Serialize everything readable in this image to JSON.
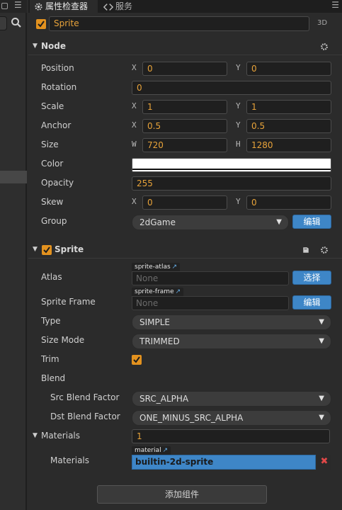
{
  "colors": {
    "accent": "#e8a33a",
    "checkbox": "#e3921f",
    "button_blue": "#3e86c7",
    "remove_red": "#e04848"
  },
  "tabs": {
    "inspector_label": "属性检查器",
    "services_label": "服务"
  },
  "node_name": "Sprite",
  "mode_tag": "3D",
  "node_section": {
    "title": "Node",
    "properties": {
      "position": {
        "label": "Position",
        "x_axis": "X",
        "x": "0",
        "y_axis": "Y",
        "y": "0"
      },
      "rotation": {
        "label": "Rotation",
        "value": "0"
      },
      "scale": {
        "label": "Scale",
        "x_axis": "X",
        "x": "1",
        "y_axis": "Y",
        "y": "1"
      },
      "anchor": {
        "label": "Anchor",
        "x_axis": "X",
        "x": "0.5",
        "y_axis": "Y",
        "y": "0.5"
      },
      "size": {
        "label": "Size",
        "w_axis": "W",
        "w": "720",
        "h_axis": "H",
        "h": "1280"
      },
      "color": {
        "label": "Color",
        "value": "#ffffff"
      },
      "opacity": {
        "label": "Opacity",
        "value": "255"
      },
      "skew": {
        "label": "Skew",
        "x_axis": "X",
        "x": "0",
        "y_axis": "Y",
        "y": "0"
      },
      "group": {
        "label": "Group",
        "value": "2dGame",
        "edit_button": "编辑"
      }
    }
  },
  "sprite_section": {
    "title": "Sprite",
    "enabled": true,
    "properties": {
      "atlas": {
        "label": "Atlas",
        "tag": "sprite-atlas",
        "placeholder": "None",
        "button": "选择"
      },
      "sprite_frame": {
        "label": "Sprite Frame",
        "tag": "sprite-frame",
        "placeholder": "None",
        "button": "编辑"
      },
      "type": {
        "label": "Type",
        "value": "SIMPLE"
      },
      "size_mode": {
        "label": "Size Mode",
        "value": "TRIMMED"
      },
      "trim": {
        "label": "Trim",
        "checked": true
      },
      "blend": {
        "label": "Blend"
      },
      "src_blend": {
        "label": "Src Blend Factor",
        "value": "SRC_ALPHA"
      },
      "dst_blend": {
        "label": "Dst Blend Factor",
        "value": "ONE_MINUS_SRC_ALPHA"
      },
      "materials_count": {
        "label": "Materials",
        "value": "1"
      },
      "materials_item": {
        "label": "Materials",
        "tag": "material",
        "value": "builtin-2d-sprite",
        "remove": "✖"
      }
    }
  },
  "add_component_label": "添加组件",
  "icons": {
    "inspector_tab": "gear-icon",
    "services_tab": "services-icon",
    "menu": "menu-icon",
    "search": "search-icon",
    "settings": "gear-icon",
    "docs": "book-icon",
    "external_link": "external-link-icon"
  }
}
